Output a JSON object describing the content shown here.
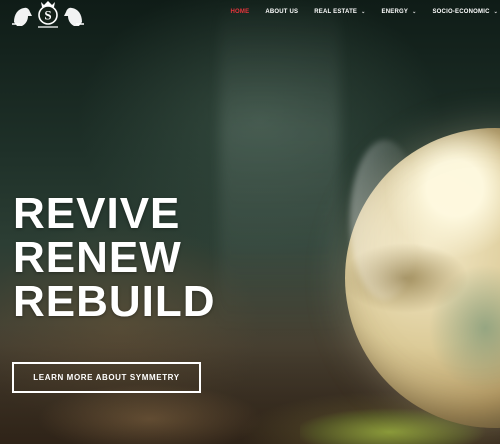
{
  "brand": {
    "logo_letter": "S",
    "logo_color": "#ffffff"
  },
  "nav": {
    "items": [
      {
        "label": "HOME",
        "active": true,
        "has_dropdown": false
      },
      {
        "label": "ABOUT US",
        "active": false,
        "has_dropdown": false
      },
      {
        "label": "REAL ESTATE",
        "active": false,
        "has_dropdown": true
      },
      {
        "label": "ENERGY",
        "active": false,
        "has_dropdown": true
      },
      {
        "label": "SOCIO-ECONOMIC",
        "active": false,
        "has_dropdown": true
      }
    ],
    "active_color": "#e8343b",
    "dropdown_icon": "chevron-down-icon"
  },
  "hero": {
    "lines": [
      "REVIVE",
      "RENEW",
      "REBUILD"
    ],
    "cta_label": "LEARN MORE ABOUT SYMMETRY",
    "background_subject": "glass globe on moss"
  }
}
